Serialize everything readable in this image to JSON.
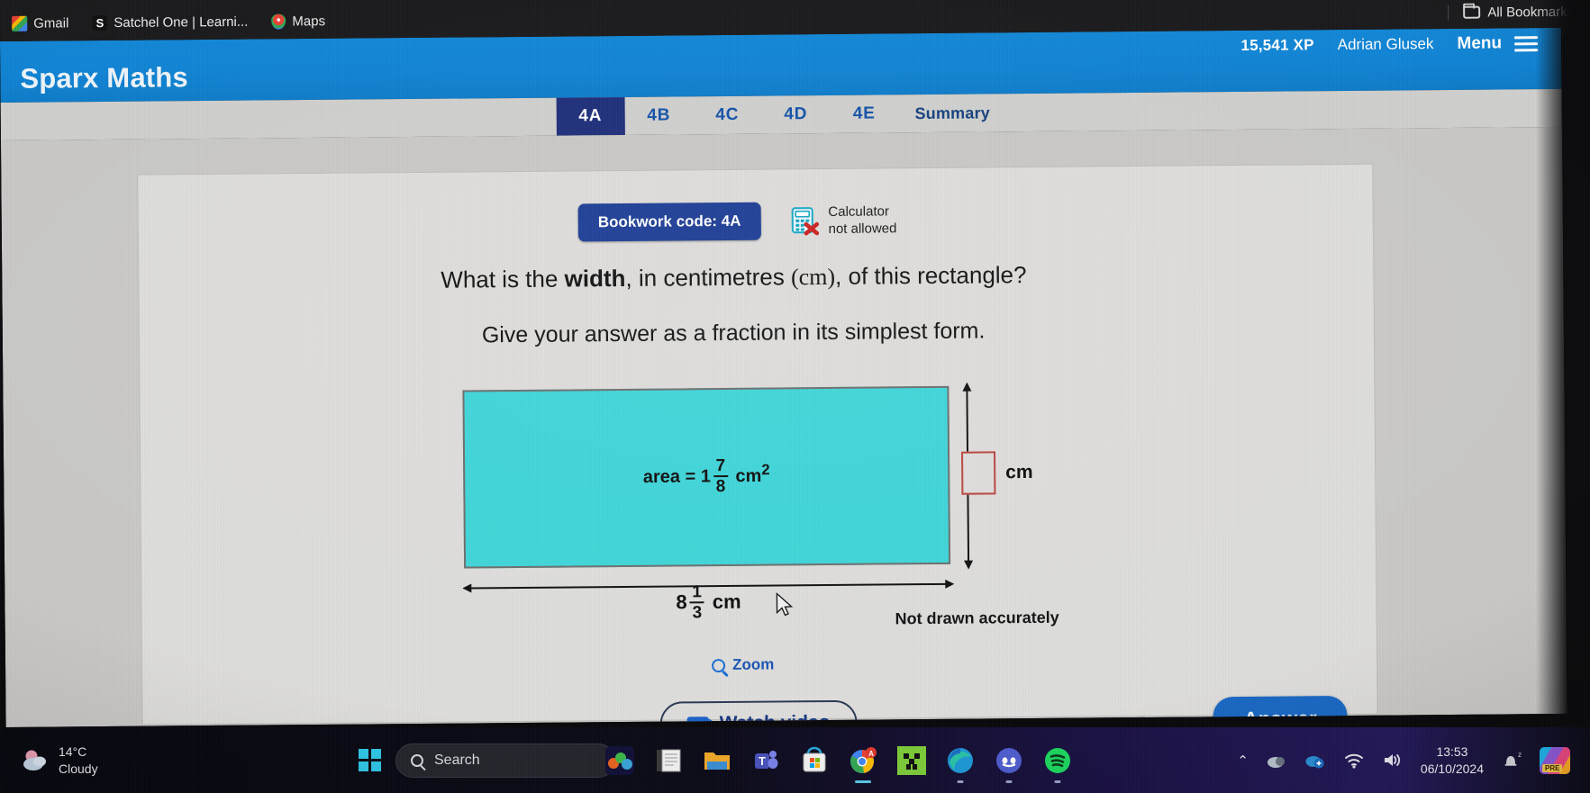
{
  "browser": {
    "bookmarks": [
      {
        "label": "Gmail",
        "icon": "gmail-icon"
      },
      {
        "label": "Satchel One | Learni...",
        "icon": "satchel-icon"
      },
      {
        "label": "Maps",
        "icon": "maps-pin-icon"
      }
    ],
    "all_bookmarks_label": "All Bookmarks",
    "all_bookmarks_icon": "folder-icon"
  },
  "app": {
    "brand": "Sparx Maths",
    "xp": "15,541 XP",
    "username": "Adrian Glusek",
    "menu_label": "Menu",
    "menu_icon": "hamburger-icon",
    "brand_bar_color": "#1184d4"
  },
  "tabs": [
    {
      "label": "4A",
      "active": true
    },
    {
      "label": "4B",
      "active": false
    },
    {
      "label": "4C",
      "active": false
    },
    {
      "label": "4D",
      "active": false
    },
    {
      "label": "4E",
      "active": false
    },
    {
      "label": "Summary",
      "active": false
    }
  ],
  "question": {
    "bookwork_code": "Bookwork code: 4A",
    "calculator_line1": "Calculator",
    "calculator_line2": "not allowed",
    "calculator_icon": "calculator-not-allowed-icon",
    "prompt_part1": "What is the ",
    "prompt_bold": "width",
    "prompt_part2": ", in centimetres ",
    "prompt_unit": "(cm)",
    "prompt_part3": ", of this rectangle?",
    "instruction": "Give your answer as a fraction in its simplest form.",
    "not_drawn": "Not drawn accurately",
    "zoom_label": "Zoom",
    "zoom_icon": "magnifier-icon"
  },
  "diagram": {
    "area_prefix": "area",
    "area_equals": "=",
    "area_whole": "1",
    "area_numerator": "7",
    "area_denominator": "8",
    "area_unit": "cm",
    "area_exponent": "2",
    "length_whole": "8",
    "length_numerator": "1",
    "length_denominator": "3",
    "length_unit": "cm",
    "answer_unit": "cm",
    "answer_value": "",
    "rect_fill": "#3fd5d8",
    "answer_box_border": "#b9453f"
  },
  "actions": {
    "watch_video": "Watch video",
    "watch_video_icon": "video-camera-icon",
    "answer": "Answer"
  },
  "taskbar": {
    "weather_temp": "14°C",
    "weather_condition": "Cloudy",
    "weather_icon": "cloud-icon",
    "start_icon": "windows-logo-icon",
    "search_placeholder": "Search",
    "search_icon": "search-icon",
    "apps": [
      {
        "name": "mario-game-icon"
      },
      {
        "name": "notepad-icon"
      },
      {
        "name": "file-explorer-icon"
      },
      {
        "name": "microsoft-teams-icon"
      },
      {
        "name": "microsoft-store-icon"
      },
      {
        "name": "google-chrome-icon"
      },
      {
        "name": "minecraft-icon"
      },
      {
        "name": "microsoft-edge-icon"
      },
      {
        "name": "discord-icon"
      },
      {
        "name": "spotify-icon"
      }
    ],
    "tray": {
      "chevron": "⌃",
      "icons": [
        "onedrive-icon",
        "cloud-sync-icon",
        "wifi-icon",
        "volume-icon"
      ],
      "time": "13:53",
      "date": "06/10/2024",
      "notification_icon": "notification-bell-icon",
      "copilot_icon": "copilot-pre-icon"
    }
  }
}
